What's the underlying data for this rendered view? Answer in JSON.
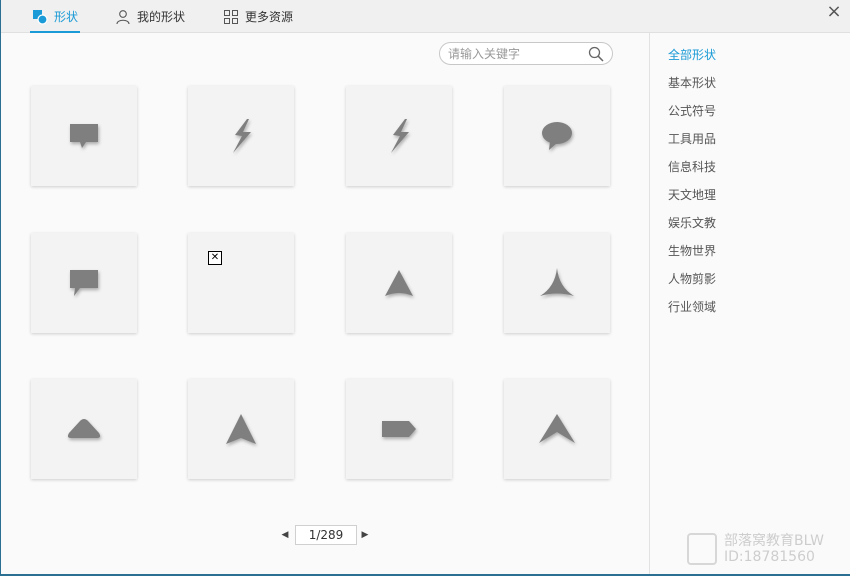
{
  "tabs": [
    {
      "label": "形状",
      "icon": "shape-icon",
      "active": true
    },
    {
      "label": "我的形状",
      "icon": "user-icon",
      "active": false
    },
    {
      "label": "更多资源",
      "icon": "grid-icon",
      "active": false
    }
  ],
  "close_label": "×",
  "search": {
    "placeholder": "请输入关键字",
    "value": ""
  },
  "shapes": [
    {
      "icon": "speech-bubble-rect-icon"
    },
    {
      "icon": "lightning-bolt-icon"
    },
    {
      "icon": "lightning-bolt-icon"
    },
    {
      "icon": "speech-bubble-oval-icon"
    },
    {
      "icon": "speech-bubble-left-tail-icon"
    },
    {
      "icon": "broken-image-icon"
    },
    {
      "icon": "triangle-arrow-icon"
    },
    {
      "icon": "concave-arrow-icon"
    },
    {
      "icon": "rounded-triangle-icon"
    },
    {
      "icon": "arrowhead-notched-icon"
    },
    {
      "icon": "pentagon-tag-icon"
    },
    {
      "icon": "chevron-arrowhead-icon"
    }
  ],
  "pager": {
    "prev": "◀",
    "next": "▶",
    "current": "1/289"
  },
  "categories": [
    {
      "label": "全部形状",
      "active": true
    },
    {
      "label": "基本形状",
      "active": false
    },
    {
      "label": "公式符号",
      "active": false
    },
    {
      "label": "工具用品",
      "active": false
    },
    {
      "label": "信息科技",
      "active": false
    },
    {
      "label": "天文地理",
      "active": false
    },
    {
      "label": "娱乐文教",
      "active": false
    },
    {
      "label": "生物世界",
      "active": false
    },
    {
      "label": "人物剪影",
      "active": false
    },
    {
      "label": "行业领域",
      "active": false
    }
  ],
  "watermark": {
    "line1": "部落窝教育BLW",
    "line2": "ID:18781560"
  },
  "colors": {
    "accent": "#1a9ad6",
    "shape_fill": "#7f7f7f",
    "frame_border": "#2b6f93"
  }
}
